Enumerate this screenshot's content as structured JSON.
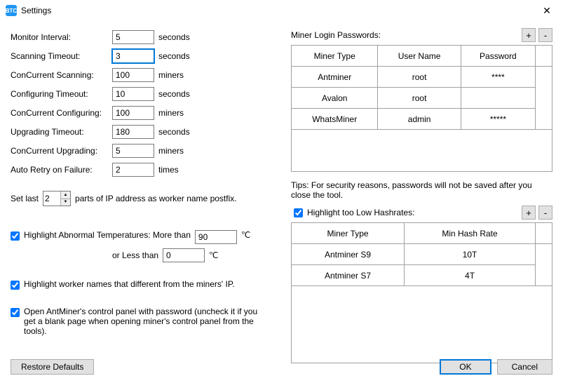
{
  "window": {
    "icon_text": "BTC",
    "title": "Settings",
    "close_glyph": "✕"
  },
  "left": {
    "monitor_interval": {
      "label": "Monitor Interval:",
      "value": "5",
      "unit": "seconds"
    },
    "scanning_timeout": {
      "label": "Scanning Timeout:",
      "value": "3",
      "unit": "seconds"
    },
    "concurrent_scanning": {
      "label": "ConCurrent Scanning:",
      "value": "100",
      "unit": "miners"
    },
    "configuring_timeout": {
      "label": "Configuring Timeout:",
      "value": "10",
      "unit": "seconds"
    },
    "concurrent_configuring": {
      "label": "ConCurrent Configuring:",
      "value": "100",
      "unit": "miners"
    },
    "upgrading_timeout": {
      "label": "Upgrading Timeout:",
      "value": "180",
      "unit": "seconds"
    },
    "concurrent_upgrading": {
      "label": "ConCurrent Upgrading:",
      "value": "5",
      "unit": "miners"
    },
    "auto_retry": {
      "label": "Auto Retry on Failure:",
      "value": "2",
      "unit": "times"
    },
    "setlast": {
      "prefix": "Set last",
      "value": "2",
      "suffix": "parts of IP address as worker name postfix."
    },
    "highlight_temp": {
      "checked": true,
      "label_prefix": "Highlight Abnormal Temperatures: More than",
      "more_value": "90",
      "more_unit": "℃",
      "less_label": "or Less than",
      "less_value": "0",
      "less_unit": "℃"
    },
    "highlight_worker": {
      "checked": true,
      "label": "Highlight worker names that different from the miners' IP."
    },
    "open_control": {
      "checked": true,
      "label": "Open AntMiner's control panel with password (uncheck it if you get a blank page when opening miner's control panel from the tools)."
    }
  },
  "right": {
    "passwords": {
      "title": "Miner Login Passwords:",
      "add": "+",
      "remove": "-",
      "headers": [
        "Miner Type",
        "User Name",
        "Password"
      ],
      "rows": [
        [
          "Antminer",
          "root",
          "****"
        ],
        [
          "Avalon",
          "root",
          ""
        ],
        [
          "WhatsMiner",
          "admin",
          "*****"
        ]
      ]
    },
    "tips": "Tips: For security reasons, passwords will not be saved after you close the tool.",
    "hashrates": {
      "checked": true,
      "label": "Highlight too Low Hashrates:",
      "add": "+",
      "remove": "-",
      "headers": [
        "Miner Type",
        "Min Hash Rate"
      ],
      "rows": [
        [
          "Antminer S9",
          "10T"
        ],
        [
          "Antminer S7",
          "4T"
        ]
      ]
    }
  },
  "footer": {
    "restore": "Restore Defaults",
    "ok": "OK",
    "cancel": "Cancel"
  }
}
